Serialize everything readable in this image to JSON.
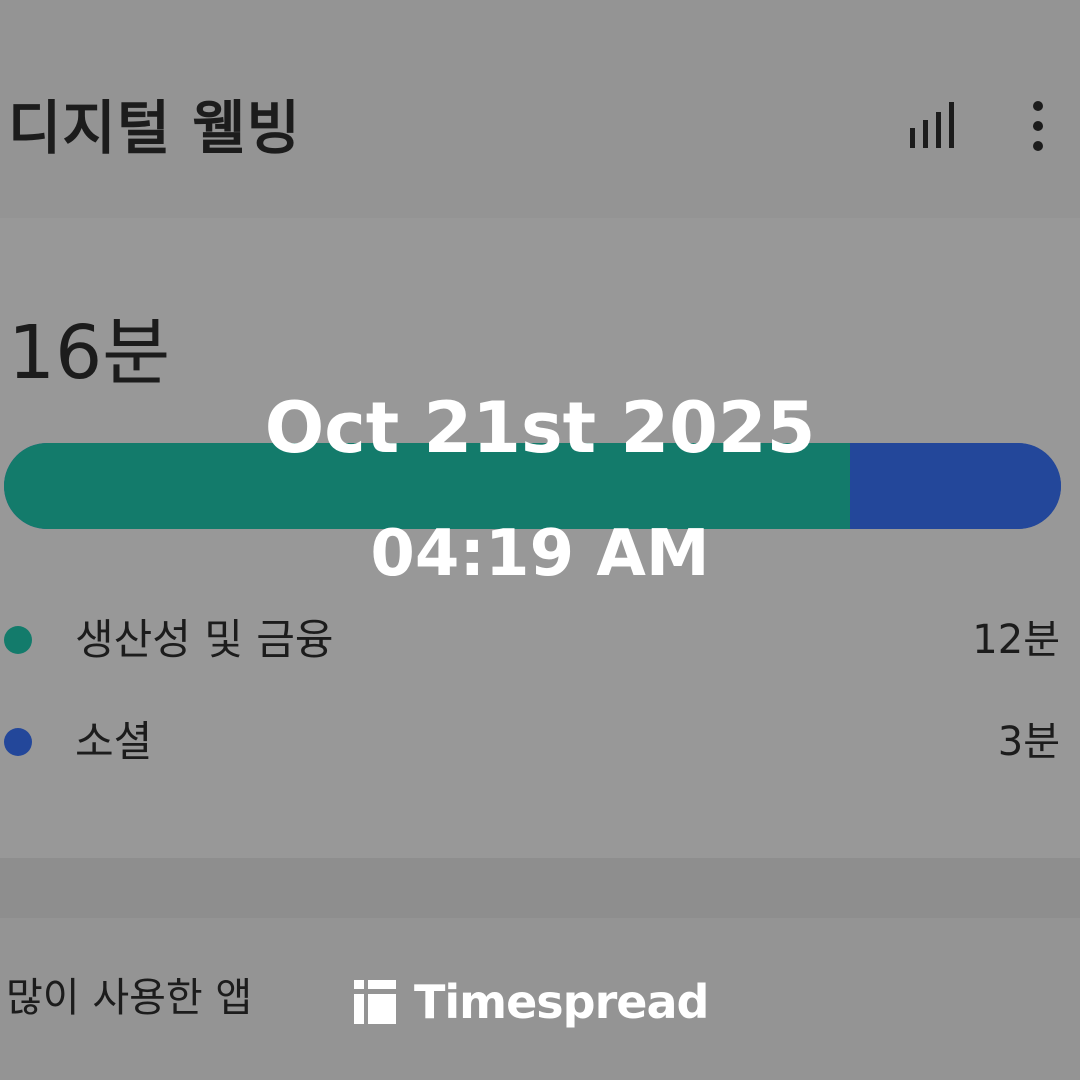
{
  "header": {
    "title": "디지털 웰빙",
    "icons": [
      "bar-chart-icon",
      "more-vert-icon"
    ]
  },
  "summary": {
    "total_time": "16분",
    "bar": {
      "segments": [
        {
          "label": "생산성 및 금융",
          "fraction": 0.8,
          "color": "#137b6b"
        },
        {
          "label": "소셜",
          "fraction": 0.2,
          "color": "#23479a"
        }
      ]
    }
  },
  "categories": [
    {
      "label": "생산성 및 금융",
      "value": "12분",
      "color": "#137b6b"
    },
    {
      "label": "소셜",
      "value": "3분",
      "color": "#23479a"
    }
  ],
  "most_used": {
    "title": "많이 사용한 앱"
  },
  "overlay": {
    "date": "Oct 21st 2025",
    "time": "04:19 AM",
    "watermark": "Timespread"
  },
  "colors": {
    "background": "#949494",
    "productivity": "#137b6b",
    "social": "#23479a",
    "overlay_text": "#ffffff"
  }
}
